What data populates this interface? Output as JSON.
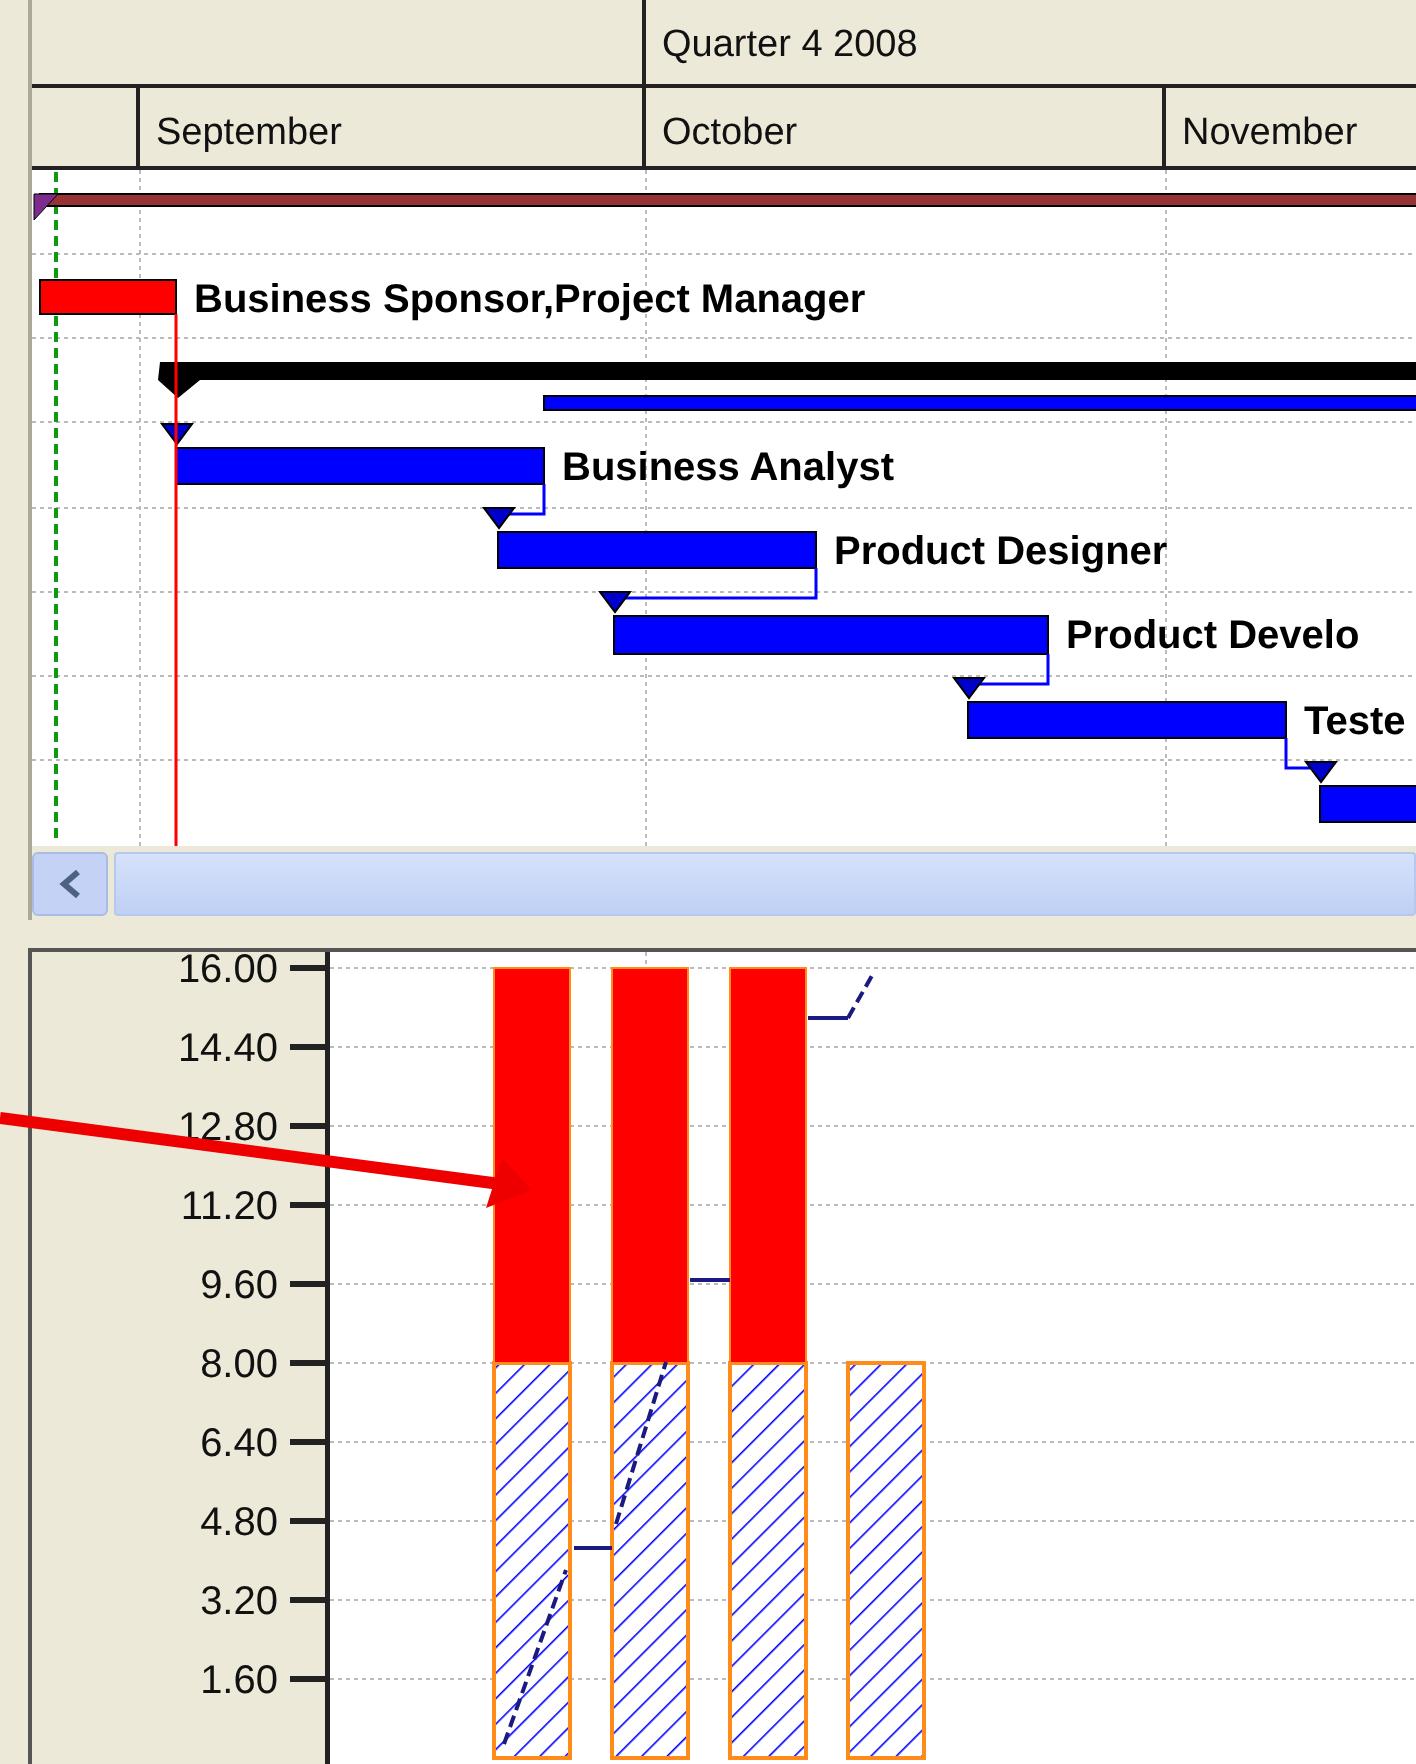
{
  "timescale": {
    "quarter": "Quarter 4 2008",
    "months": [
      "September",
      "October",
      "November"
    ]
  },
  "tasks": [
    {
      "kind": "project_summary"
    },
    {
      "kind": "critical",
      "label": "Business Sponsor,Project Manager"
    },
    {
      "kind": "summary"
    },
    {
      "kind": "task",
      "label": "Business Analyst"
    },
    {
      "kind": "task",
      "label": "Product Designer"
    },
    {
      "kind": "task",
      "label": "Product Develo"
    },
    {
      "kind": "task",
      "label": "Teste"
    },
    {
      "kind": "task"
    }
  ],
  "resource_graph": {
    "chart_data": {
      "type": "bar",
      "stacked": true,
      "grid": true,
      "ylim": [
        0,
        16
      ],
      "yticks": [
        {
          "value": 1.6,
          "label": "1.60"
        },
        {
          "value": 3.2,
          "label": "3.20"
        },
        {
          "value": 4.8,
          "label": "4.80"
        },
        {
          "value": 6.4,
          "label": "6.40"
        },
        {
          "value": 8,
          "label": "8.00"
        },
        {
          "value": 9.6,
          "label": "9.60"
        },
        {
          "value": 11.2,
          "label": "11.20"
        },
        {
          "value": 12.8,
          "label": "12.80"
        },
        {
          "value": 14.4,
          "label": "14.40"
        },
        {
          "value": 16,
          "label": "16.00"
        }
      ],
      "series": [
        {
          "color": "#ff8c1a",
          "values": [
            8,
            8,
            8,
            8
          ]
        },
        {
          "color": "#ff0000",
          "values": [
            8,
            8,
            8,
            null
          ]
        }
      ]
    }
  }
}
